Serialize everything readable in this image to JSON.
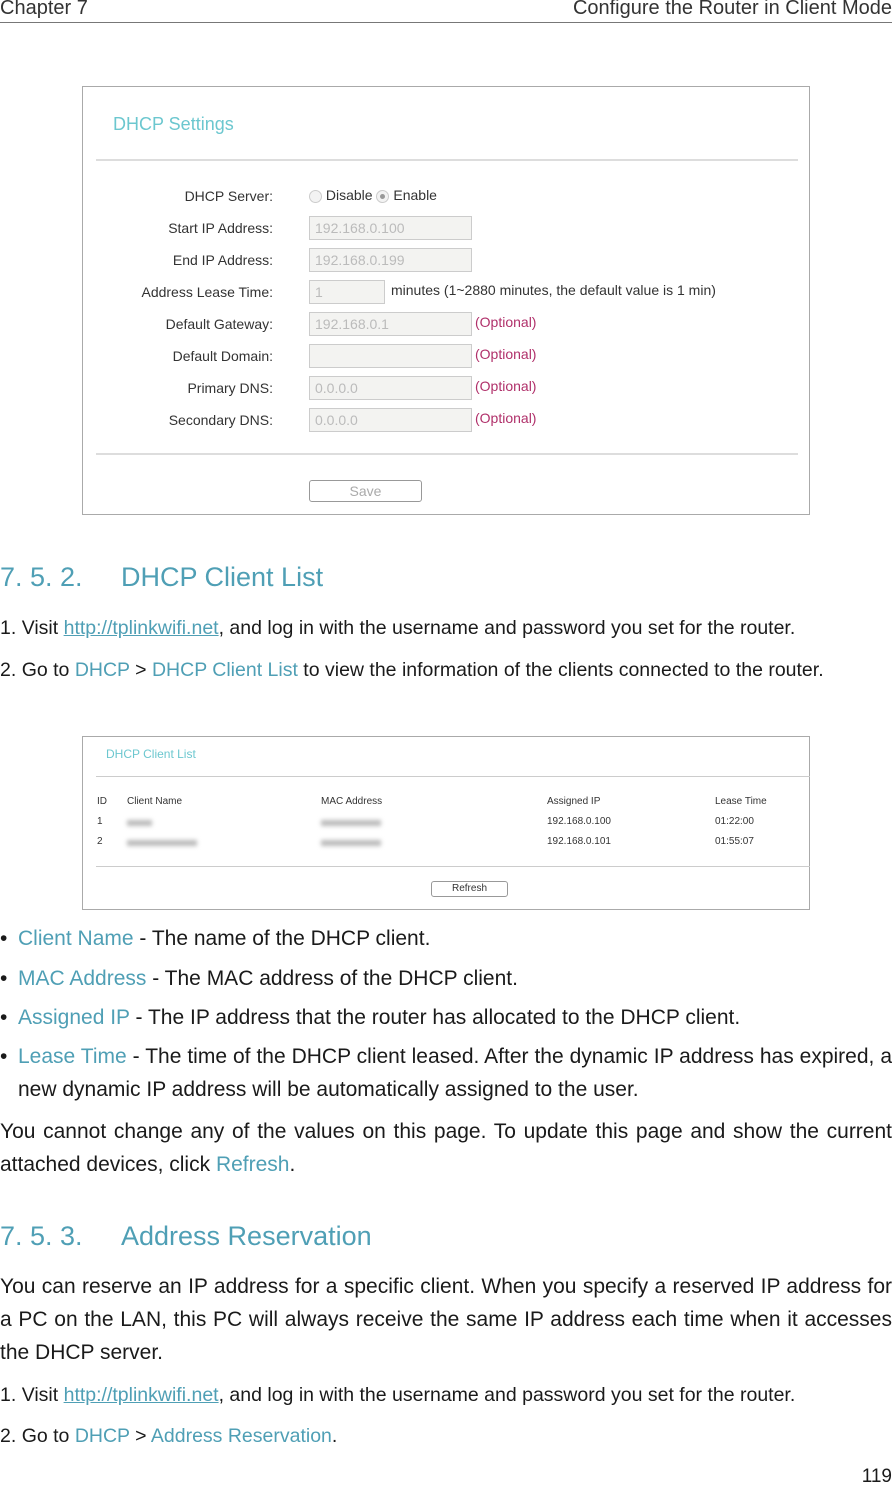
{
  "header": {
    "chapter": "Chapter 7",
    "title": "Configure the Router in Client Mode"
  },
  "dhcp_settings": {
    "title": "DHCP Settings",
    "server_label": "DHCP Server:",
    "disable": "Disable",
    "enable": "Enable",
    "selected": "Enable",
    "fields": [
      {
        "label": "Start IP Address:",
        "value": "192.168.0.100",
        "note": ""
      },
      {
        "label": "End IP Address:",
        "value": "192.168.0.199",
        "note": ""
      },
      {
        "label": "Address Lease Time:",
        "value": "1",
        "note": "minutes (1~2880 minutes, the default value is 1 min)"
      },
      {
        "label": "Default Gateway:",
        "value": "192.168.0.1",
        "note": "(Optional)"
      },
      {
        "label": "Default Domain:",
        "value": "",
        "note": "(Optional)"
      },
      {
        "label": "Primary DNS:",
        "value": "0.0.0.0",
        "note": "(Optional)"
      },
      {
        "label": "Secondary DNS:",
        "value": "0.0.0.0",
        "note": "(Optional)"
      }
    ],
    "save": "Save"
  },
  "s752": {
    "num": "7. 5. 2.",
    "title": "DHCP Client List",
    "step1": {
      "n": "1.",
      "pre": "Visit ",
      "link": "http://tplinkwifi.net",
      "post": ", and log in with the username and password you set for the router."
    },
    "step2": {
      "n": "2.",
      "pre": "Go to ",
      "a": "DHCP",
      "sep": " > ",
      "b": "DHCP Client List",
      "post": " to view the information of the clients connected to the router."
    }
  },
  "client_list": {
    "title": "DHCP Client List",
    "columns": [
      "ID",
      "Client Name",
      "MAC Address",
      "Assigned IP",
      "Lease Time"
    ],
    "rows": [
      {
        "id": "1",
        "ip": "192.168.0.100",
        "lease": "01:22:00"
      },
      {
        "id": "2",
        "ip": "192.168.0.101",
        "lease": "01:55:07"
      }
    ],
    "refresh": "Refresh"
  },
  "bullets": [
    {
      "term": "Client Name",
      "text": " - The name of the DHCP client."
    },
    {
      "term": "MAC Address",
      "text": " - The MAC address of the DHCP client."
    },
    {
      "term": "Assigned IP",
      "text": " - The IP address that the router has allocated to the DHCP client."
    },
    {
      "term": "Lease Time",
      "text": " - The time of the DHCP client leased. After the dynamic IP address has expired, a new dynamic IP address will be automatically assigned to the user."
    }
  ],
  "note": {
    "pre": "You cannot change any of the values on this page. To update this page and show the current attached devices, click ",
    "link": "Refresh",
    "post": "."
  },
  "s753": {
    "num": "7. 5. 3.",
    "title": "Address Reservation",
    "intro": "You can reserve an IP address for a specific client. When you specify a reserved IP address for a PC on the LAN, this PC will always receive the same IP address each time when it accesses the DHCP server.",
    "step1": {
      "n": "1.",
      "pre": "Visit ",
      "link": "http://tplinkwifi.net",
      "post": ", and log in with the username and password you set for the router."
    },
    "step2": {
      "n": "2.",
      "pre": "Go to ",
      "a": "DHCP",
      "sep": " > ",
      "b": "Address Reservation",
      "post": "."
    }
  },
  "page_number": "119"
}
